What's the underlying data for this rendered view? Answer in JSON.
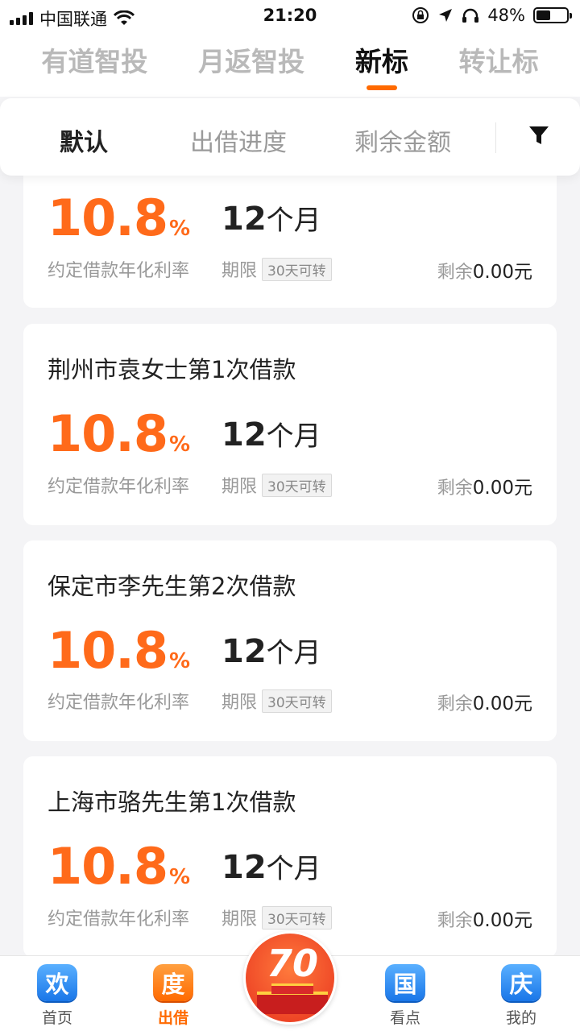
{
  "status_bar": {
    "carrier": "中国联通",
    "time": "21:20",
    "battery": "48%"
  },
  "top_tabs": [
    {
      "label": "有道智投",
      "active": false
    },
    {
      "label": "月返智投",
      "active": false
    },
    {
      "label": "新标",
      "active": true
    },
    {
      "label": "转让标",
      "active": false
    }
  ],
  "sort_bar": {
    "items": [
      "默认",
      "出借进度",
      "剩余金额"
    ],
    "active_index": 0
  },
  "cards": [
    {
      "title": "",
      "rate": "10.8",
      "rate_unit": "%",
      "term_num": "12",
      "term_unit": "个月",
      "rate_label": "约定借款年化利率",
      "term_label": "期限",
      "tag": "30天可转",
      "remain_label": "剩余",
      "remain_amount": "0.00元"
    },
    {
      "title": "荆州市袁女士第1次借款",
      "rate": "10.8",
      "rate_unit": "%",
      "term_num": "12",
      "term_unit": "个月",
      "rate_label": "约定借款年化利率",
      "term_label": "期限",
      "tag": "30天可转",
      "remain_label": "剩余",
      "remain_amount": "0.00元"
    },
    {
      "title": "保定市李先生第2次借款",
      "rate": "10.8",
      "rate_unit": "%",
      "term_num": "12",
      "term_unit": "个月",
      "rate_label": "约定借款年化利率",
      "term_label": "期限",
      "tag": "30天可转",
      "remain_label": "剩余",
      "remain_amount": "0.00元"
    },
    {
      "title": "上海市骆先生第1次借款",
      "rate": "10.8",
      "rate_unit": "%",
      "term_num": "12",
      "term_unit": "个月",
      "rate_label": "约定借款年化利率",
      "term_label": "期限",
      "tag": "30天可转",
      "remain_label": "剩余",
      "remain_amount": "0.00元"
    }
  ],
  "bottom_nav": [
    {
      "icon_char": "欢",
      "label": "首页",
      "active": false
    },
    {
      "icon_char": "度",
      "label": "出借",
      "active": true
    },
    {
      "icon_char": "国",
      "label": "看点",
      "active": false
    },
    {
      "icon_char": "庆",
      "label": "我的",
      "active": false
    }
  ],
  "center_badge": {
    "text": "70"
  },
  "colors": {
    "accent": "#ff6a00",
    "rate": "#ff6a1a",
    "nav_blue": "#1976e8"
  }
}
